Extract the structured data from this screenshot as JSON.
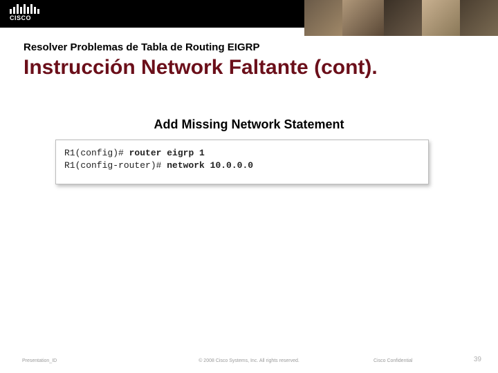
{
  "brand": {
    "wordmark": "CISCO"
  },
  "headings": {
    "kicker": "Resolver Problemas de Tabla de Routing EIGRP",
    "title": "Instrucción Network Faltante (cont)."
  },
  "subhead": "Add Missing Network Statement",
  "code": {
    "lines": [
      {
        "prompt": "R1(config)# ",
        "command": "router eigrp 1"
      },
      {
        "prompt": "R1(config-router)# ",
        "command": "network 10.0.0.0"
      }
    ]
  },
  "footer": {
    "presentation_id": "Presentation_ID",
    "copyright": "© 2008 Cisco Systems, Inc. All rights reserved.",
    "confidential": "Cisco Confidential",
    "page": "39"
  }
}
